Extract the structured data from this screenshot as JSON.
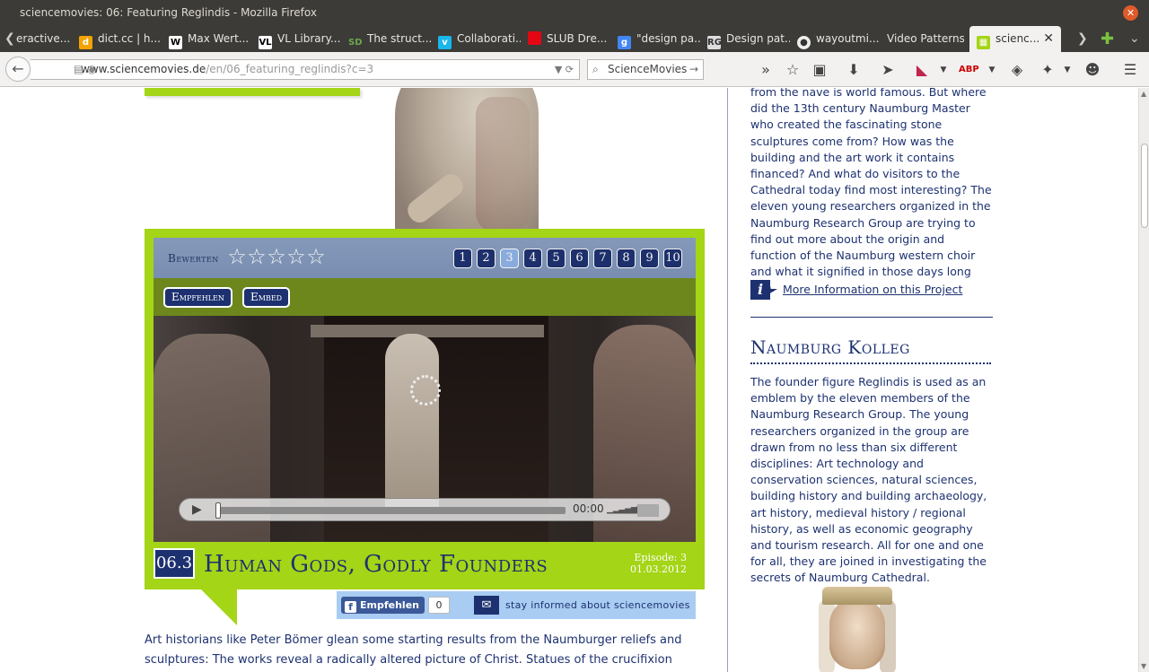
{
  "window": {
    "title": "sciencemovies: 06: Featuring Reglindis - Mozilla Firefox",
    "close_symbol": "✕"
  },
  "tabs": [
    {
      "label": "eractive...",
      "icon": "generic-tab-icon",
      "color": "#3c3b37"
    },
    {
      "label": "dict.cc | h...",
      "icon": "dictcc-icon",
      "color": "#f4a300"
    },
    {
      "label": "Max Wert...",
      "icon": "wikipedia-icon",
      "color": "#ffffff"
    },
    {
      "label": "VL Library...",
      "icon": "vl-icon",
      "color": "#ffffff"
    },
    {
      "label": "The struct...",
      "icon": "sd-icon",
      "color": "#6aa84f"
    },
    {
      "label": "Collaborati...",
      "icon": "vimeo-icon",
      "color": "#1ab7ea"
    },
    {
      "label": "SLUB Dre...",
      "icon": "slub-icon",
      "color": "#e30613"
    },
    {
      "label": "\"design pa...",
      "icon": "google-icon",
      "color": "#4285f4"
    },
    {
      "label": "Design pat...",
      "icon": "researchgate-icon",
      "color": "#dddddd"
    },
    {
      "label": "wayoutmi...",
      "icon": "github-icon",
      "color": "#333333"
    },
    {
      "label": "Video Patterns",
      "icon": "",
      "color": ""
    },
    {
      "label": "scienc...",
      "icon": "sciencemovies-icon",
      "color": "#a4d516",
      "active": true
    }
  ],
  "navbar": {
    "url_host": "www.sciencemovies.de",
    "url_path": "/en/06_featuring_reglindis?c=3",
    "search_engine": "ScienceMovies"
  },
  "video": {
    "rating_label": "Bewerten",
    "stars": 5,
    "pages": [
      "1",
      "2",
      "3",
      "4",
      "5",
      "6",
      "7",
      "8",
      "9",
      "10"
    ],
    "active_page": "3",
    "recommend_label": "Empfehlen",
    "embed_label": "Embed",
    "time": "00:00"
  },
  "episode": {
    "number": "06.3",
    "title": "Human Gods, Godly Founders",
    "label": "Episode: 3",
    "date": "01.03.2012"
  },
  "share": {
    "fb_label": "Empfehlen",
    "fb_count": "0",
    "stay_informed": "stay informed about sciencemovies"
  },
  "article": {
    "text": "Art historians like Peter Bömer glean some starting results from the Naumburger reliefs and sculptures: The works reveal a radically altered picture of Christ. Statues of the crucifixion depicted"
  },
  "sidebar": {
    "text1": "from the nave is world famous. But where did the 13th century Naumburg Master who created the fascinating stone sculptures come from? How was the building and the art work it contains financed? And what do visitors to the Cathedral today find most interesting? The eleven young researchers organized in the Naumburg Research Group are trying to find out more about the origin and function of the Naumburg western choir and what it signified in those days long ago.",
    "more_info": "More Information on this Project",
    "heading": "Naumburg Kolleg",
    "text2": "The founder figure Reglindis is used as an emblem by the eleven members of the Naumburg Research Group. The young researchers organized in the group are drawn from no less than six different disciplines: Art technology and conservation sciences, natural sciences, building history and building archaeology, art history, medieval history / regional history, as well as economic geography and tourism research. All for one and one for all, they are joined in investigating the secrets of Naumburg Cathedral."
  },
  "colors": {
    "green": "#a4d516",
    "navy": "#1d3170",
    "light_blue": "#a9ccf2"
  }
}
